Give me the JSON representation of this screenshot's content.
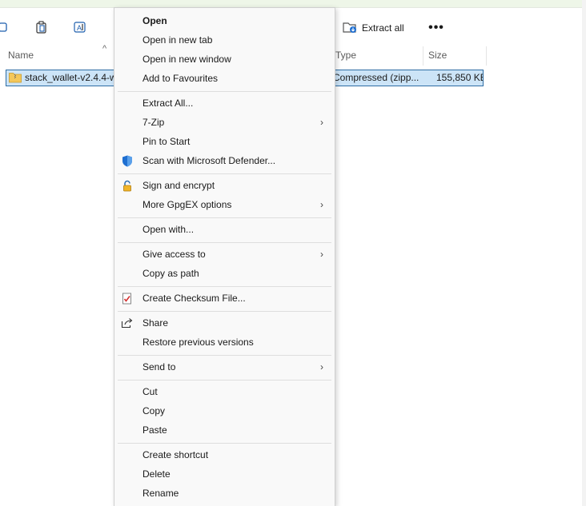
{
  "toolbar": {
    "extract_all_label": "Extract all",
    "more_label": "•••"
  },
  "columns": {
    "name": "Name",
    "type": "Type",
    "size": "Size"
  },
  "file": {
    "name": "stack_wallet-v2.4.4-w",
    "type": "Compressed (zipp...",
    "size": "155,850 KB"
  },
  "menu": {
    "items": [
      {
        "label": "Open"
      },
      {
        "label": "Open in new tab"
      },
      {
        "label": "Open in new window"
      },
      {
        "label": "Add to Favourites"
      },
      {
        "label": "Extract All..."
      },
      {
        "label": "7-Zip"
      },
      {
        "label": "Pin to Start"
      },
      {
        "label": "Scan with Microsoft Defender..."
      },
      {
        "label": "Sign and encrypt"
      },
      {
        "label": "More GpgEX options"
      },
      {
        "label": "Open with..."
      },
      {
        "label": "Give access to"
      },
      {
        "label": "Copy as path"
      },
      {
        "label": "Create Checksum File..."
      },
      {
        "label": "Share"
      },
      {
        "label": "Restore previous versions"
      },
      {
        "label": "Send to"
      },
      {
        "label": "Cut"
      },
      {
        "label": "Copy"
      },
      {
        "label": "Paste"
      },
      {
        "label": "Create shortcut"
      },
      {
        "label": "Delete"
      },
      {
        "label": "Rename"
      }
    ]
  },
  "colors": {
    "selection_bg": "#cce4f7",
    "selection_border": "#2f6ea4",
    "menu_bg": "#f9f9f9",
    "defender_blue": "#1f6fd1"
  }
}
